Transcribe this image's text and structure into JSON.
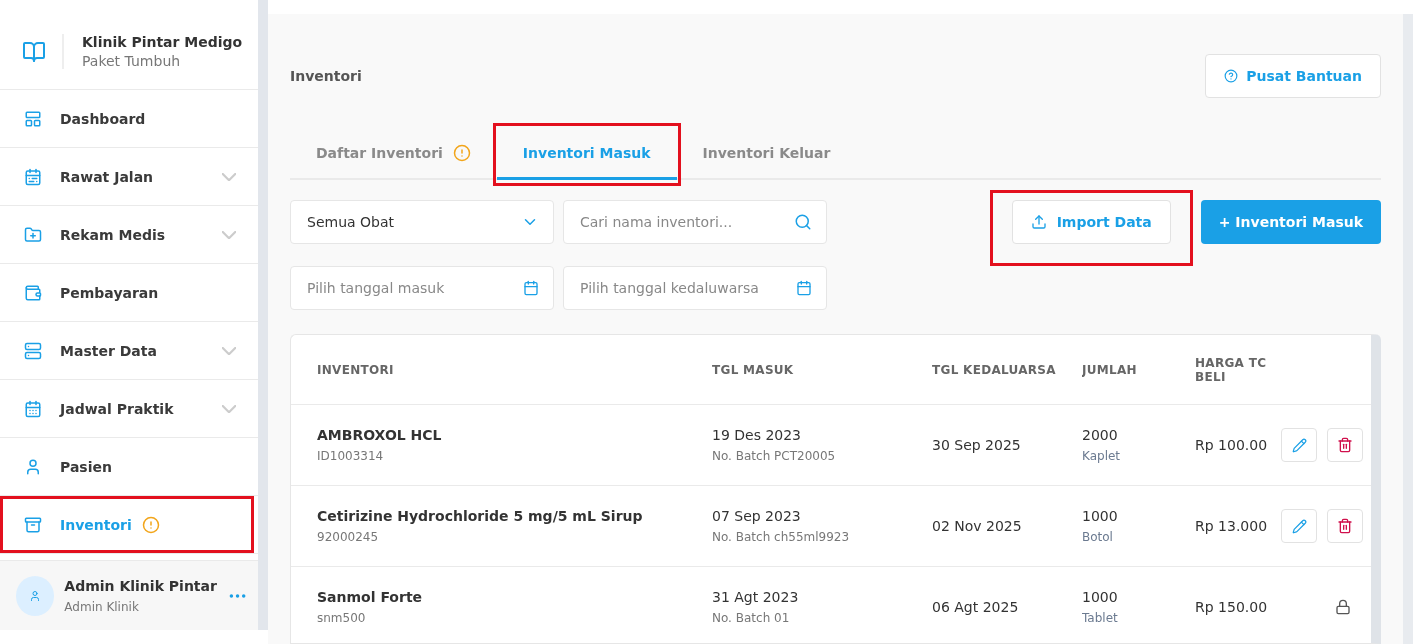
{
  "clinic": {
    "name": "Klinik Pintar Medigo",
    "plan": "Paket Tumbuh"
  },
  "sidebar": {
    "items": [
      {
        "label": "Dashboard",
        "selected": false,
        "expandable": false,
        "alert": false,
        "highlighted": false
      },
      {
        "label": "Rawat Jalan",
        "selected": false,
        "expandable": true,
        "alert": false,
        "highlighted": false
      },
      {
        "label": "Rekam Medis",
        "selected": false,
        "expandable": true,
        "alert": false,
        "highlighted": false
      },
      {
        "label": "Pembayaran",
        "selected": false,
        "expandable": false,
        "alert": false,
        "highlighted": false
      },
      {
        "label": "Master Data",
        "selected": false,
        "expandable": true,
        "alert": false,
        "highlighted": false
      },
      {
        "label": "Jadwal Praktik",
        "selected": false,
        "expandable": true,
        "alert": false,
        "highlighted": false
      },
      {
        "label": "Pasien",
        "selected": false,
        "expandable": false,
        "alert": false,
        "highlighted": false
      },
      {
        "label": "Inventori",
        "selected": true,
        "expandable": false,
        "alert": true,
        "highlighted": true
      }
    ]
  },
  "user": {
    "name": "Admin Klinik Pintar",
    "role": "Admin Klinik"
  },
  "page_title": "Inventori",
  "help_button": "Pusat Bantuan",
  "tabs": [
    {
      "label": "Daftar Inventori",
      "selected": false,
      "alert": true,
      "highlighted": false
    },
    {
      "label": "Inventori Masuk",
      "selected": true,
      "alert": false,
      "highlighted": true
    },
    {
      "label": "Inventori Keluar",
      "selected": false,
      "alert": false,
      "highlighted": false
    }
  ],
  "filters": {
    "category": "Semua Obat",
    "search_placeholder": "Cari nama inventori...",
    "date_in_placeholder": "Pilih tanggal masuk",
    "expiry_placeholder": "Pilih tanggal kedaluwarsa"
  },
  "import_button": {
    "label": "Import Data",
    "highlighted": true
  },
  "add_button": "+ Inventori Masuk",
  "table": {
    "columns": [
      "INVENTORI",
      "TGL MASUK",
      "TGL KEDALUARSA",
      "JUMLAH",
      "HARGA TC BELI"
    ],
    "rows": [
      {
        "name": "AMBROXOL HCL",
        "code": "ID1003314",
        "date_in": "19 Des 2023",
        "batch": "No. Batch PCT20005",
        "expiry": "30 Sep 2025",
        "qty": "2000",
        "unit": "Kaplet",
        "price": "Rp 100.00",
        "locked": false
      },
      {
        "name": "Cetirizine Hydrochloride 5 mg/5 mL Sirup",
        "code": "92000245",
        "date_in": "07 Sep 2023",
        "batch": "No. Batch ch55ml9923",
        "expiry": "02 Nov 2025",
        "qty": "1000",
        "unit": "Botol",
        "price": "Rp 13.000",
        "locked": false
      },
      {
        "name": "Sanmol Forte",
        "code": "snm500",
        "date_in": "31 Agt 2023",
        "batch": "No. Batch 01",
        "expiry": "06 Agt 2025",
        "qty": "1000",
        "unit": "Tablet",
        "price": "Rp 150.00",
        "locked": true
      }
    ]
  }
}
